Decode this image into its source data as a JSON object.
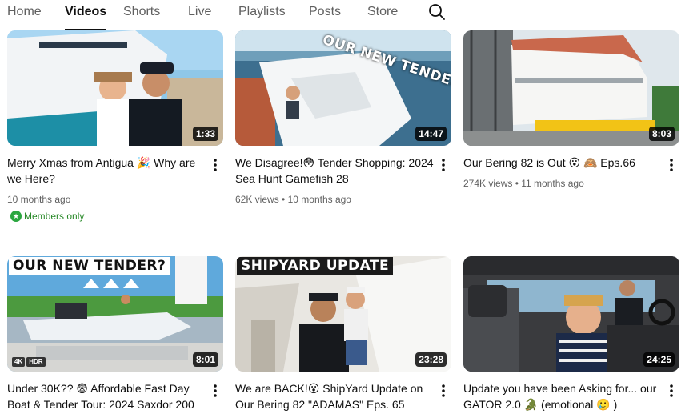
{
  "tabs": [
    {
      "label": "Home",
      "active": false
    },
    {
      "label": "Videos",
      "active": true
    },
    {
      "label": "Shorts",
      "active": false
    },
    {
      "label": "Live",
      "active": false
    },
    {
      "label": "Playlists",
      "active": false
    },
    {
      "label": "Posts",
      "active": false
    },
    {
      "label": "Store",
      "active": false
    }
  ],
  "search_icon": "search-icon",
  "videos": [
    {
      "title": "Merry Xmas from Antigua 🎉 Why are we Here?",
      "views": "",
      "age": "10 months ago",
      "duration": "1:33",
      "members_label": "Members only",
      "overlay": ""
    },
    {
      "title": "We Disagree!😳 Tender Shopping: 2024 Sea Hunt Gamefish 28",
      "views": "62K views",
      "age": "10 months ago",
      "duration": "14:47",
      "overlay": "OUR NEW TENDER?"
    },
    {
      "title": "Our Bering 82 is Out 😮 🙈 Eps.66",
      "views": "274K views",
      "age": "11 months ago",
      "duration": "8:03",
      "overlay": ""
    },
    {
      "title": "Under 30K?? 😨 Affordable Fast Day Boat & Tender Tour: 2024 Saxdor 200",
      "views": "",
      "age": "",
      "duration": "8:01",
      "overlay": "OUR NEW TENDER?",
      "badges": [
        "4K",
        "HDR"
      ]
    },
    {
      "title": "We are BACK!😮 ShipYard Update on Our Bering 82 \"ADAMAS\" Eps. 65",
      "views": "",
      "age": "",
      "duration": "23:28",
      "overlay": "SHIPYARD UPDATE"
    },
    {
      "title": "Update you have been Asking for... our GATOR 2.0 🐊 (emotional 🥲 )",
      "views": "",
      "age": "",
      "duration": "24:25",
      "overlay": ""
    }
  ],
  "separator": "•",
  "colors": {
    "members_green": "#2ba640",
    "text_primary": "#0f0f0f",
    "text_secondary": "#606060"
  }
}
